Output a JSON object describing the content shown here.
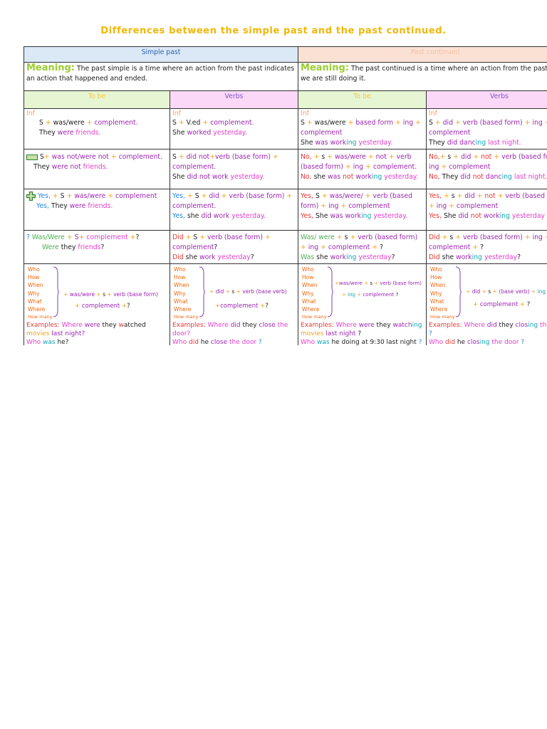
{
  "title": "Differences between the simple past and the past continued.",
  "headers": {
    "simple_past": "Simple past",
    "past_continued": "Past continued"
  },
  "meaning": {
    "label": "Meaning:",
    "simple": "The past simple is a time where an action from the past indicates an action that happened and ended.",
    "continued": "The past continued is a time where an action from the past, but we are still doing it."
  },
  "subheaders": {
    "tobe": "To be",
    "verbs": "Verbs"
  },
  "cells": {
    "inf": "Inf",
    "sp_tobe_aff_formula": [
      "S",
      "+",
      "was/were",
      "+",
      "complement."
    ],
    "sp_tobe_aff_example": [
      "They",
      "were",
      "friends."
    ],
    "sp_verb_aff_formula": [
      "S",
      "+",
      "V.ed",
      "+",
      "complement."
    ],
    "sp_verb_aff_example": [
      "She",
      "worked",
      "yesterday."
    ],
    "pc_tobe_aff_formula": [
      "S",
      "+",
      "was/were",
      "+",
      "based form",
      "+",
      "ing",
      "+",
      "complement"
    ],
    "pc_tobe_aff_example": [
      "She",
      "was",
      "work",
      "ing",
      "yesterday."
    ],
    "pc_verb_aff_formula": [
      "S",
      "+",
      "did",
      "+",
      "verb (based form)",
      "+",
      "ing",
      "+",
      "complement"
    ],
    "pc_verb_aff_example": [
      "They",
      "did",
      "danc",
      "ing",
      "last night."
    ],
    "sp_tobe_neg_formula": [
      "S",
      "+",
      "was not/were not",
      "+",
      "complement."
    ],
    "sp_tobe_neg_example": [
      "They",
      "were",
      "not",
      "friends."
    ],
    "sp_verb_neg_formula": [
      "S",
      "+",
      "did not",
      "+",
      "verb (base form)",
      "+",
      "complement."
    ],
    "sp_verb_neg_example": [
      "She",
      "did",
      "not",
      "work",
      "yesterday."
    ],
    "pc_tobe_neg_formula": [
      "No,",
      "+",
      "s",
      "+",
      "was/were",
      "+",
      "not",
      "+",
      "verb",
      "(based form)",
      "+",
      "ing",
      "+",
      "complement."
    ],
    "pc_tobe_neg_example": [
      "No,",
      "she",
      "was",
      "not",
      "work",
      "ing",
      "yesterday."
    ],
    "pc_verb_neg_formula": [
      "No,",
      "+",
      "s",
      "+",
      "did",
      "+",
      "not",
      "+",
      "verb (based form)",
      "+",
      "ing",
      "+",
      "complement"
    ],
    "pc_verb_neg_example": [
      "No,",
      "They",
      "did",
      "not",
      "danc",
      "ing",
      "last night."
    ],
    "sp_tobe_yes_formula": [
      "Yes,",
      "+",
      "S",
      "+",
      "was/were",
      "+",
      "complement"
    ],
    "sp_tobe_yes_example": [
      "Yes,",
      "They",
      "were",
      "friends."
    ],
    "sp_verb_yes_formula": [
      "Yes,",
      "+",
      "S",
      "+",
      "did",
      "+",
      "verb (base form)",
      "+",
      "complement."
    ],
    "sp_verb_yes_example": [
      "Yes,",
      "she",
      "did",
      "work",
      "yesterday."
    ],
    "pc_tobe_yes_formula": [
      "Yes,",
      "S",
      "+",
      "was/were/",
      "+",
      "verb (based form)",
      "+",
      "ing",
      "+",
      "complement"
    ],
    "pc_tobe_yes_example": [
      "Yes,",
      "She",
      "was",
      "work",
      "ing",
      "yesterday."
    ],
    "pc_verb_yes_formula": [
      "Yes,",
      "+",
      "s",
      "+",
      "did",
      "+",
      "not",
      "+",
      "verb (based form)",
      "+",
      "ing",
      "+",
      "complement"
    ],
    "pc_verb_yes_example": [
      "Yes,",
      "She",
      "did",
      "not",
      "work",
      "ing",
      "yesterday"
    ],
    "sp_tobe_q_formula": [
      "?",
      "Was/Were",
      "+",
      "S",
      "+",
      "complement",
      "+",
      "?"
    ],
    "sp_tobe_q_example": [
      "Were",
      "they",
      "friends",
      "?"
    ],
    "sp_verb_q_formula": [
      "Did",
      "+",
      "S",
      "+",
      "verb (base form)",
      "+",
      "complement",
      "?"
    ],
    "sp_verb_q_example": [
      "Did",
      "she",
      "work",
      "yesterday",
      "?"
    ],
    "pc_tobe_q_formula": [
      "Was/ were",
      "+",
      "s",
      "+",
      "verb (based form)",
      "+",
      "ing",
      "+",
      "complement",
      "+",
      "?"
    ],
    "pc_tobe_q_example": [
      "Was",
      "she",
      "work",
      "ing",
      "yesterday",
      "?"
    ],
    "pc_verb_q_formula": [
      "Did",
      "+",
      "s",
      "+",
      "verb (based form)",
      "+",
      "ing",
      "+",
      "complement",
      "+",
      "?"
    ],
    "pc_verb_q_example": [
      "Did",
      "she",
      "work",
      "ing",
      "yesterday",
      "?"
    ]
  },
  "wh": {
    "words": [
      "Who",
      "How",
      "When",
      "Why",
      "What",
      "Where",
      "How many"
    ],
    "sp_tobe_f1": [
      "+",
      "was/were",
      "+",
      "s",
      "+",
      "verb (base form)"
    ],
    "sp_tobe_f2": [
      "+",
      "complement",
      "+",
      "?"
    ],
    "sp_verb_f1": [
      "+",
      "did",
      "+",
      "s",
      "+",
      "verb (base verb)"
    ],
    "sp_verb_f2": [
      "+",
      "complement",
      "+",
      "?"
    ],
    "pc_tobe_f1": [
      "+",
      "was/were",
      "+",
      "s",
      "+",
      "verb (base form)"
    ],
    "pc_tobe_f2": [
      "+",
      "ing",
      "+",
      "complement",
      "?"
    ],
    "pc_verb_f1": [
      "+",
      "did",
      "+",
      "s",
      "+",
      "(base verb)",
      "+",
      "ing"
    ],
    "pc_verb_f2": [
      "+",
      "complement",
      "+",
      "?"
    ],
    "sp_tobe_ex": [
      "Examples:",
      "Where",
      "were",
      "they",
      "w",
      "atched",
      "movies",
      "last night?"
    ],
    "sp_tobe_ex2": [
      "Who",
      "was",
      "he?"
    ],
    "sp_verb_ex": [
      "Examples:",
      "Where",
      "did",
      "they",
      "close",
      "the",
      "door?"
    ],
    "sp_verb_ex2": [
      "Who",
      "did",
      "he",
      "close",
      "the door",
      "?"
    ],
    "pc_tobe_ex": [
      "Examples:",
      "Where",
      "were",
      "they",
      "watch",
      "ing",
      "movies",
      "last night",
      "?"
    ],
    "pc_tobe_ex2": [
      "Who",
      "was",
      "he doing at 9:30 last night",
      "?"
    ],
    "pc_verb_ex": [
      "Examples:",
      "Where",
      "did",
      "they",
      "clos",
      "ing",
      "the",
      "door",
      "?"
    ],
    "pc_verb_ex2": [
      "Who",
      "did",
      "he",
      "clos",
      "ing",
      "the door",
      "?"
    ]
  },
  "icons": {
    "minus": "minus-icon",
    "plus": "plus-icon"
  }
}
